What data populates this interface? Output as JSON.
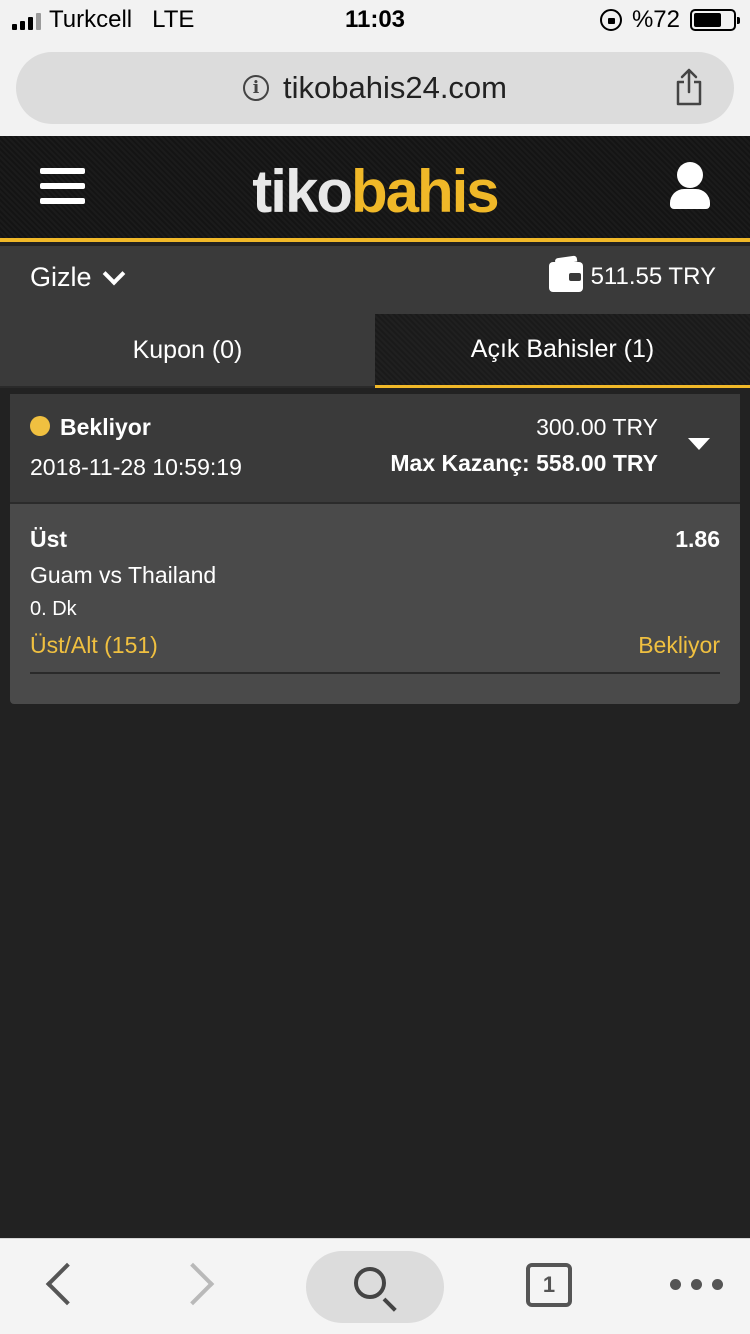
{
  "status_bar": {
    "carrier": "Turkcell",
    "network": "LTE",
    "time": "11:03",
    "battery": "%72",
    "battery_level": 0.72
  },
  "browser": {
    "url": "tikobahis24.com",
    "tab_count": "1"
  },
  "header": {
    "logo_white": "tiko",
    "logo_yellow": "bahis",
    "accent_color": "#f0b828"
  },
  "balance_row": {
    "hide_label": "Gizle",
    "balance": "511.55 TRY"
  },
  "tabs": [
    {
      "label": "Kupon (0)",
      "active": false
    },
    {
      "label": "Açık Bahisler (1)",
      "active": true
    }
  ],
  "bet": {
    "status": "Bekliyor",
    "date": "2018-11-28 10:59:19",
    "stake": "300.00 TRY",
    "max_win": "Max Kazanç: 558.00 TRY",
    "selection": {
      "name": "Üst",
      "odd": "1.86",
      "match": "Guam vs Thailand",
      "minute": "0. Dk",
      "market": "Üst/Alt (151)",
      "status": "Bekliyor"
    }
  }
}
